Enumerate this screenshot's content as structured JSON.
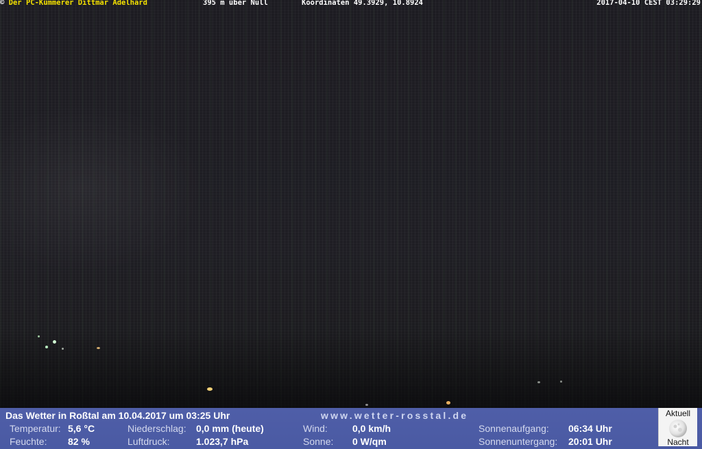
{
  "overlay": {
    "copyright_symbol": "©",
    "owner": "Der PC-Kümmerer Dittmar Adelhard",
    "altitude": "395 m über Null",
    "coordinates": "Koordinaten 49.3929, 10.8924",
    "timestamp": "2017-04-10 CEST 03:29:29"
  },
  "panel": {
    "title": "Das Wetter in Roßtal am 10.04.2017 um 03:25 Uhr",
    "website": "www.wetter-rosstal.de",
    "temperature": {
      "label": "Temperatur:",
      "value": "5,6 °C"
    },
    "humidity": {
      "label": "Feuchte:",
      "value": "82 %"
    },
    "precipitation": {
      "label": "Niederschlag:",
      "value": "0,0 mm (heute)"
    },
    "pressure": {
      "label": "Luftdruck:",
      "value": "1.023,7 hPa"
    },
    "wind": {
      "label": "Wind:",
      "value": "0,0 km/h"
    },
    "sun": {
      "label": "Sonne:",
      "value": "0 W/qm"
    },
    "sunrise": {
      "label": "Sonnenaufgang:",
      "value": "06:34 Uhr"
    },
    "sunset": {
      "label": "Sonnenuntergang:",
      "value": "20:01 Uhr"
    },
    "moon": {
      "top_label": "Aktuell",
      "bottom_label": "Nacht",
      "icon": "moon-icon"
    }
  },
  "colors": {
    "overlay_owner": "#f5e200",
    "overlay_text": "#ffffff",
    "panel_bg": "#4f5ea8",
    "camera_bg": "#1f1e24"
  }
}
